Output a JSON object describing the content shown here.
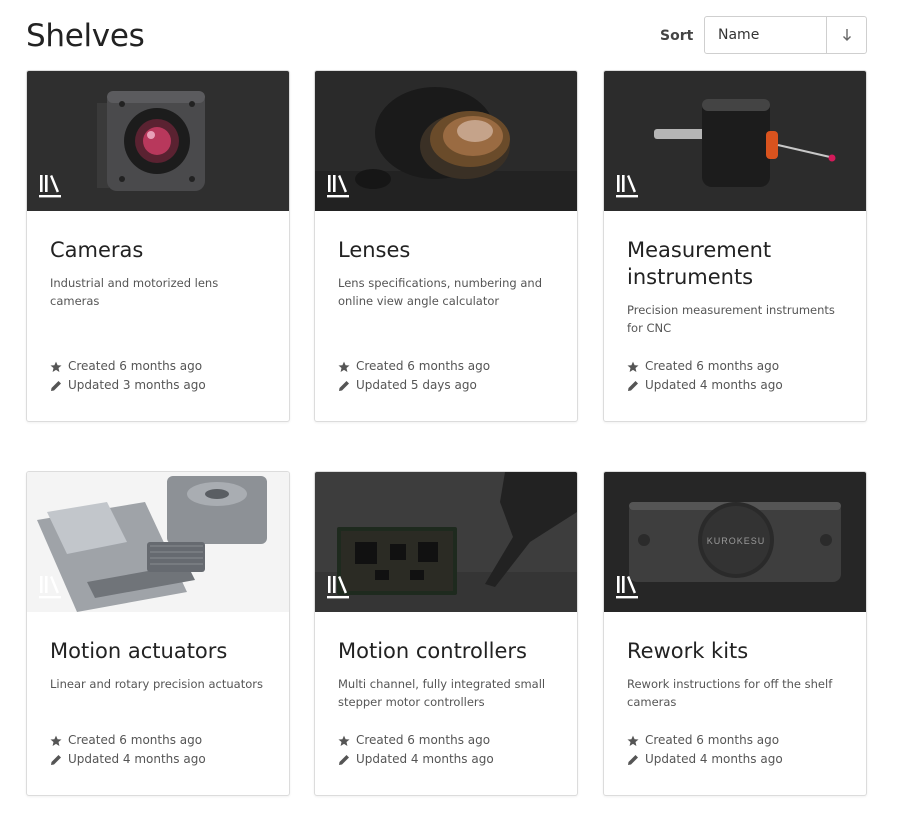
{
  "header": {
    "title": "Shelves",
    "sort_label": "Sort",
    "sort_value": "Name",
    "sort_direction_icon": "arrow-down-icon"
  },
  "shelves": [
    {
      "title": "Cameras",
      "description": "Industrial and motorized lens cameras",
      "created": "Created 6 months ago",
      "updated": "Updated 3 months ago"
    },
    {
      "title": "Lenses",
      "description": "Lens specifications, numbering and online view angle calculator",
      "created": "Created 6 months ago",
      "updated": "Updated 5 days ago"
    },
    {
      "title": "Measurement instruments",
      "description": "Precision measurement instruments for CNC",
      "created": "Created 6 months ago",
      "updated": "Updated 4 months ago"
    },
    {
      "title": "Motion actuators",
      "description": "Linear and rotary precision actuators",
      "created": "Created 6 months ago",
      "updated": "Updated 4 months ago"
    },
    {
      "title": "Motion controllers",
      "description": "Multi channel, fully integrated small stepper motor controllers",
      "created": "Created 6 months ago",
      "updated": "Updated 4 months ago"
    },
    {
      "title": "Rework kits",
      "description": "Rework instructions for off the shelf cameras",
      "created": "Created 6 months ago",
      "updated": "Updated 4 months ago"
    }
  ],
  "product_label": "KUROKESU",
  "icons": {
    "shelf": "bookshelf-icon",
    "created": "star-icon",
    "updated": "pencil-icon"
  }
}
